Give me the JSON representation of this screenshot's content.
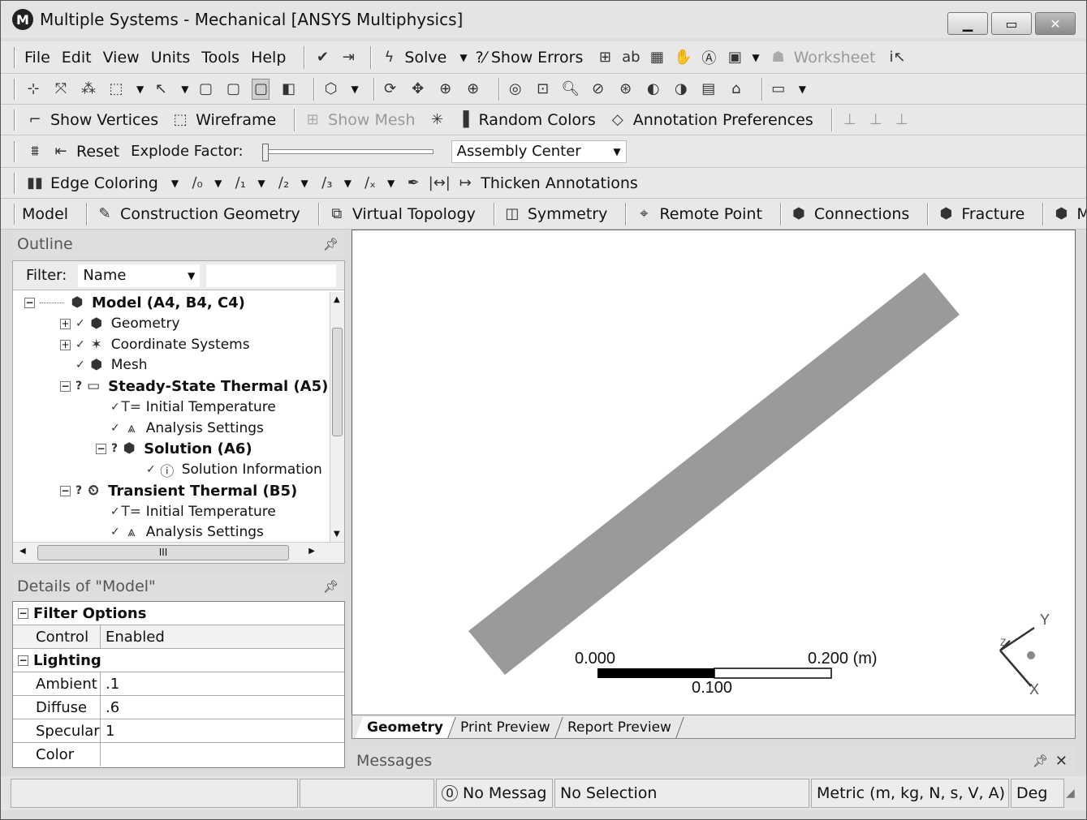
{
  "window": {
    "title": "Multiple Systems - Mechanical [ANSYS Multiphysics]",
    "logo_letter": "M"
  },
  "menu": [
    "File",
    "Edit",
    "View",
    "Units",
    "Tools",
    "Help"
  ],
  "toolbar1": {
    "solve_label": "Solve",
    "show_errors_label": "?⁄ Show Errors",
    "worksheet_label": "Worksheet"
  },
  "toolbar3": {
    "show_vertices": "Show Vertices",
    "wireframe": "Wireframe",
    "show_mesh": "Show Mesh",
    "random_colors": "Random Colors",
    "annotation_preferences": "Annotation Preferences"
  },
  "toolbar4": {
    "reset": "Reset",
    "explode_factor": "Explode Factor:",
    "assembly_center": "Assembly Center",
    "explode_value": 0
  },
  "toolbar5": {
    "edge_coloring": "Edge Coloring",
    "thicken_annotations": "Thicken Annotations"
  },
  "context_toolbar": {
    "model": "Model",
    "construction_geometry": "Construction Geometry",
    "virtual_topology": "Virtual Topology",
    "symmetry": "Symmetry",
    "remote_point": "Remote Point",
    "connections": "Connections",
    "fracture": "Fracture",
    "more": "Me"
  },
  "outline": {
    "title": "Outline",
    "filter_label": "Filter:",
    "filter_value": "Name",
    "tree": [
      {
        "label": "Model (A4, B4, C4)",
        "bold": true
      },
      {
        "label": "Geometry"
      },
      {
        "label": "Coordinate Systems"
      },
      {
        "label": "Mesh"
      },
      {
        "label": "Steady-State Thermal (A5)",
        "bold": true
      },
      {
        "label": "Initial Temperature"
      },
      {
        "label": "Analysis Settings"
      },
      {
        "label": "Solution (A6)",
        "bold": true
      },
      {
        "label": "Solution Information"
      },
      {
        "label": "Transient Thermal (B5)",
        "bold": true
      },
      {
        "label": "Initial Temperature"
      },
      {
        "label": "Analysis Settings"
      }
    ],
    "hscroll_label": "III"
  },
  "details": {
    "title": "Details of \"Model\"",
    "groups": [
      {
        "name": "Filter Options",
        "rows": [
          {
            "key": "Control",
            "value": "Enabled"
          }
        ]
      },
      {
        "name": "Lighting",
        "rows": [
          {
            "key": "Ambient",
            "value": ".1"
          },
          {
            "key": "Diffuse",
            "value": ".6"
          },
          {
            "key": "Specular",
            "value": "1"
          },
          {
            "key": "Color",
            "value": ""
          }
        ]
      }
    ]
  },
  "viewport": {
    "scale_left": "0.000",
    "scale_right": "0.200 (m)",
    "scale_mid": "0.100",
    "axis_y": "Y",
    "axis_x": "X",
    "axis_z": "Z",
    "tabs": [
      "Geometry",
      "Print Preview",
      "Report Preview"
    ]
  },
  "messages": {
    "title": "Messages"
  },
  "statusbar": {
    "messages": "No Messag",
    "message_count": "0",
    "selection": "No Selection",
    "units": "Metric (m, kg, N, s, V, A)",
    "angle": "Deg"
  },
  "colors": {
    "geometry_fill": "#9a9a9a",
    "window_bg": "#dcdcdc"
  }
}
